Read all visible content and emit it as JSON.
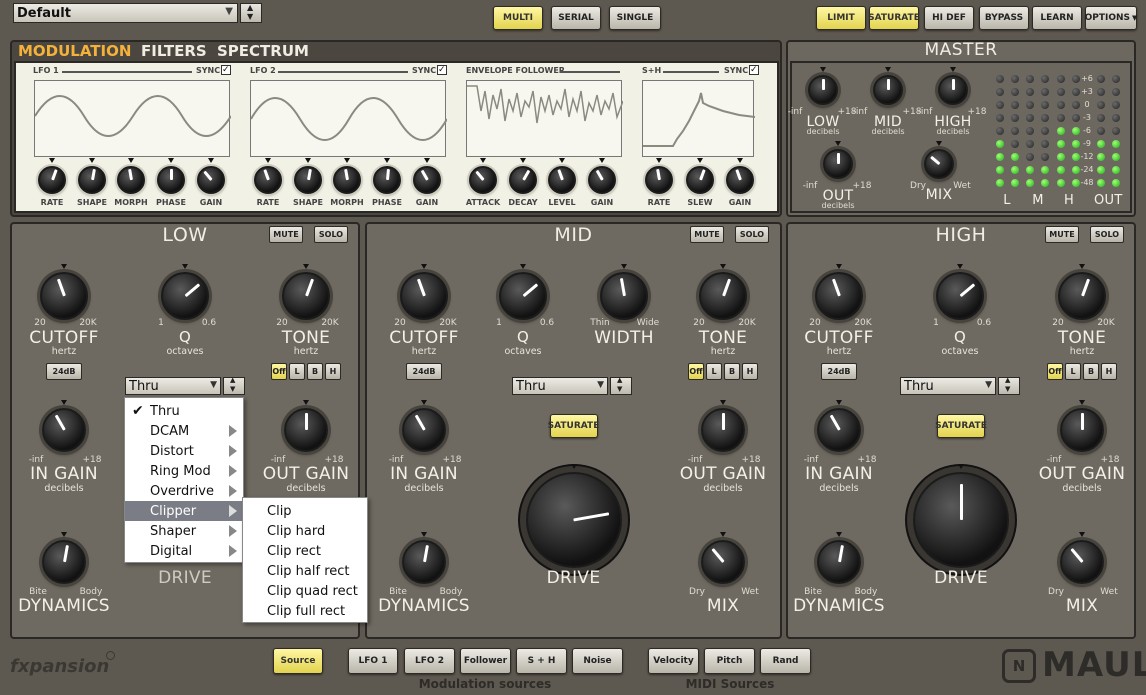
{
  "top": {
    "preset": "Default",
    "routing": [
      "MULTI",
      "SERIAL",
      "SINGLE"
    ],
    "right": [
      "LIMIT",
      "SATURATE",
      "HI DEF",
      "BYPASS",
      "LEARN",
      "OPTIONS"
    ]
  },
  "mod": {
    "tabs": [
      "MODULATION",
      "FILTERS",
      "SPECTRUM"
    ],
    "lfo1": {
      "title": "LFO 1",
      "sync": "SYNC",
      "knobs": [
        "RATE",
        "SHAPE",
        "MORPH",
        "PHASE",
        "GAIN"
      ]
    },
    "lfo2": {
      "title": "LFO 2",
      "sync": "SYNC",
      "knobs": [
        "RATE",
        "SHAPE",
        "MORPH",
        "PHASE",
        "GAIN"
      ]
    },
    "env": {
      "title": "ENVELOPE FOLLOWER",
      "knobs": [
        "ATTACK",
        "DECAY",
        "LEVEL",
        "GAIN"
      ]
    },
    "sh": {
      "title": "S+H",
      "sync": "SYNC",
      "knobs": [
        "RATE",
        "SLEW",
        "GAIN"
      ]
    }
  },
  "master": {
    "title": "MASTER",
    "low": "LOW",
    "mid": "MID",
    "high": "HIGH",
    "out": "OUT",
    "mix": "MIX",
    "unit": "decibels",
    "ninf": "-inf",
    "p18": "+18",
    "dry": "Dry",
    "wet": "Wet",
    "scale": [
      "+6",
      "+3",
      "0",
      "-3",
      "-6",
      "-9",
      "-12",
      "-24",
      "-48"
    ],
    "meters": [
      "L",
      "M",
      "H",
      "OUT"
    ]
  },
  "bands": {
    "low": {
      "title": "LOW",
      "mute": "MUTE",
      "solo": "SOLO",
      "cutoff": "CUTOFF",
      "q": "Q",
      "tone": "TONE",
      "ingain": "IN GAIN",
      "outgain": "OUT GAIN",
      "drive": "DRIVE",
      "dynamics": "DYNAMICS",
      "hertz": "hertz",
      "octaves": "octaves",
      "decibels": "decibels",
      "f20": "20",
      "f20k": "20K",
      "q1": "1",
      "q06": "0.6",
      "ninf": "-inf",
      "p18": "+18",
      "bite": "Bite",
      "body": "Body",
      "slope": "24dB",
      "mode": "Thru",
      "tonebtns": [
        "Off",
        "L",
        "B",
        "H"
      ]
    },
    "mid": {
      "title": "MID",
      "mute": "MUTE",
      "solo": "SOLO",
      "cutoff": "CUTOFF",
      "q": "Q",
      "width": "WIDTH",
      "tone": "TONE",
      "ingain": "IN GAIN",
      "outgain": "OUT GAIN",
      "drive": "DRIVE",
      "mix": "MIX",
      "dynamics": "DYNAMICS",
      "hertz": "hertz",
      "octaves": "octaves",
      "decibels": "decibels",
      "f20": "20",
      "f20k": "20K",
      "q1": "1",
      "q06": "0.6",
      "thin": "Thin",
      "wide": "Wide",
      "ninf": "-inf",
      "p18": "+18",
      "bite": "Bite",
      "body": "Body",
      "dry": "Dry",
      "wet": "Wet",
      "slope": "24dB",
      "mode": "Thru",
      "saturate": "SATURATE",
      "tonebtns": [
        "Off",
        "L",
        "B",
        "H"
      ]
    },
    "high": {
      "title": "HIGH",
      "mute": "MUTE",
      "solo": "SOLO",
      "cutoff": "CUTOFF",
      "q": "Q",
      "tone": "TONE",
      "ingain": "IN GAIN",
      "outgain": "OUT GAIN",
      "drive": "DRIVE",
      "mix": "MIX",
      "dynamics": "DYNAMICS",
      "hertz": "hertz",
      "octaves": "octaves",
      "decibels": "decibels",
      "f20": "20",
      "f20k": "20K",
      "q1": "1",
      "q06": "0.6",
      "ninf": "-inf",
      "p18": "+18",
      "bite": "Bite",
      "body": "Body",
      "dry": "Dry",
      "wet": "Wet",
      "slope": "24dB",
      "mode": "Thru",
      "saturate": "SATURATE",
      "tonebtns": [
        "Off",
        "L",
        "B",
        "H"
      ]
    }
  },
  "menu": {
    "items": [
      "Thru",
      "DCAM",
      "Distort",
      "Ring Mod",
      "Overdrive",
      "Clipper",
      "Shaper",
      "Digital"
    ],
    "sub": [
      "Clip",
      "Clip hard",
      "Clip rect",
      "Clip half rect",
      "Clip quad rect",
      "Clip full rect"
    ]
  },
  "bottom": {
    "source": "Source",
    "mod": [
      "LFO 1",
      "LFO 2",
      "Follower",
      "S + H",
      "Noise"
    ],
    "midi": [
      "Velocity",
      "Pitch",
      "Rand"
    ],
    "modcap": "Modulation sources",
    "midicap": "MIDI Sources"
  },
  "brand": {
    "left": "fxpansion",
    "right": "MAUL"
  }
}
